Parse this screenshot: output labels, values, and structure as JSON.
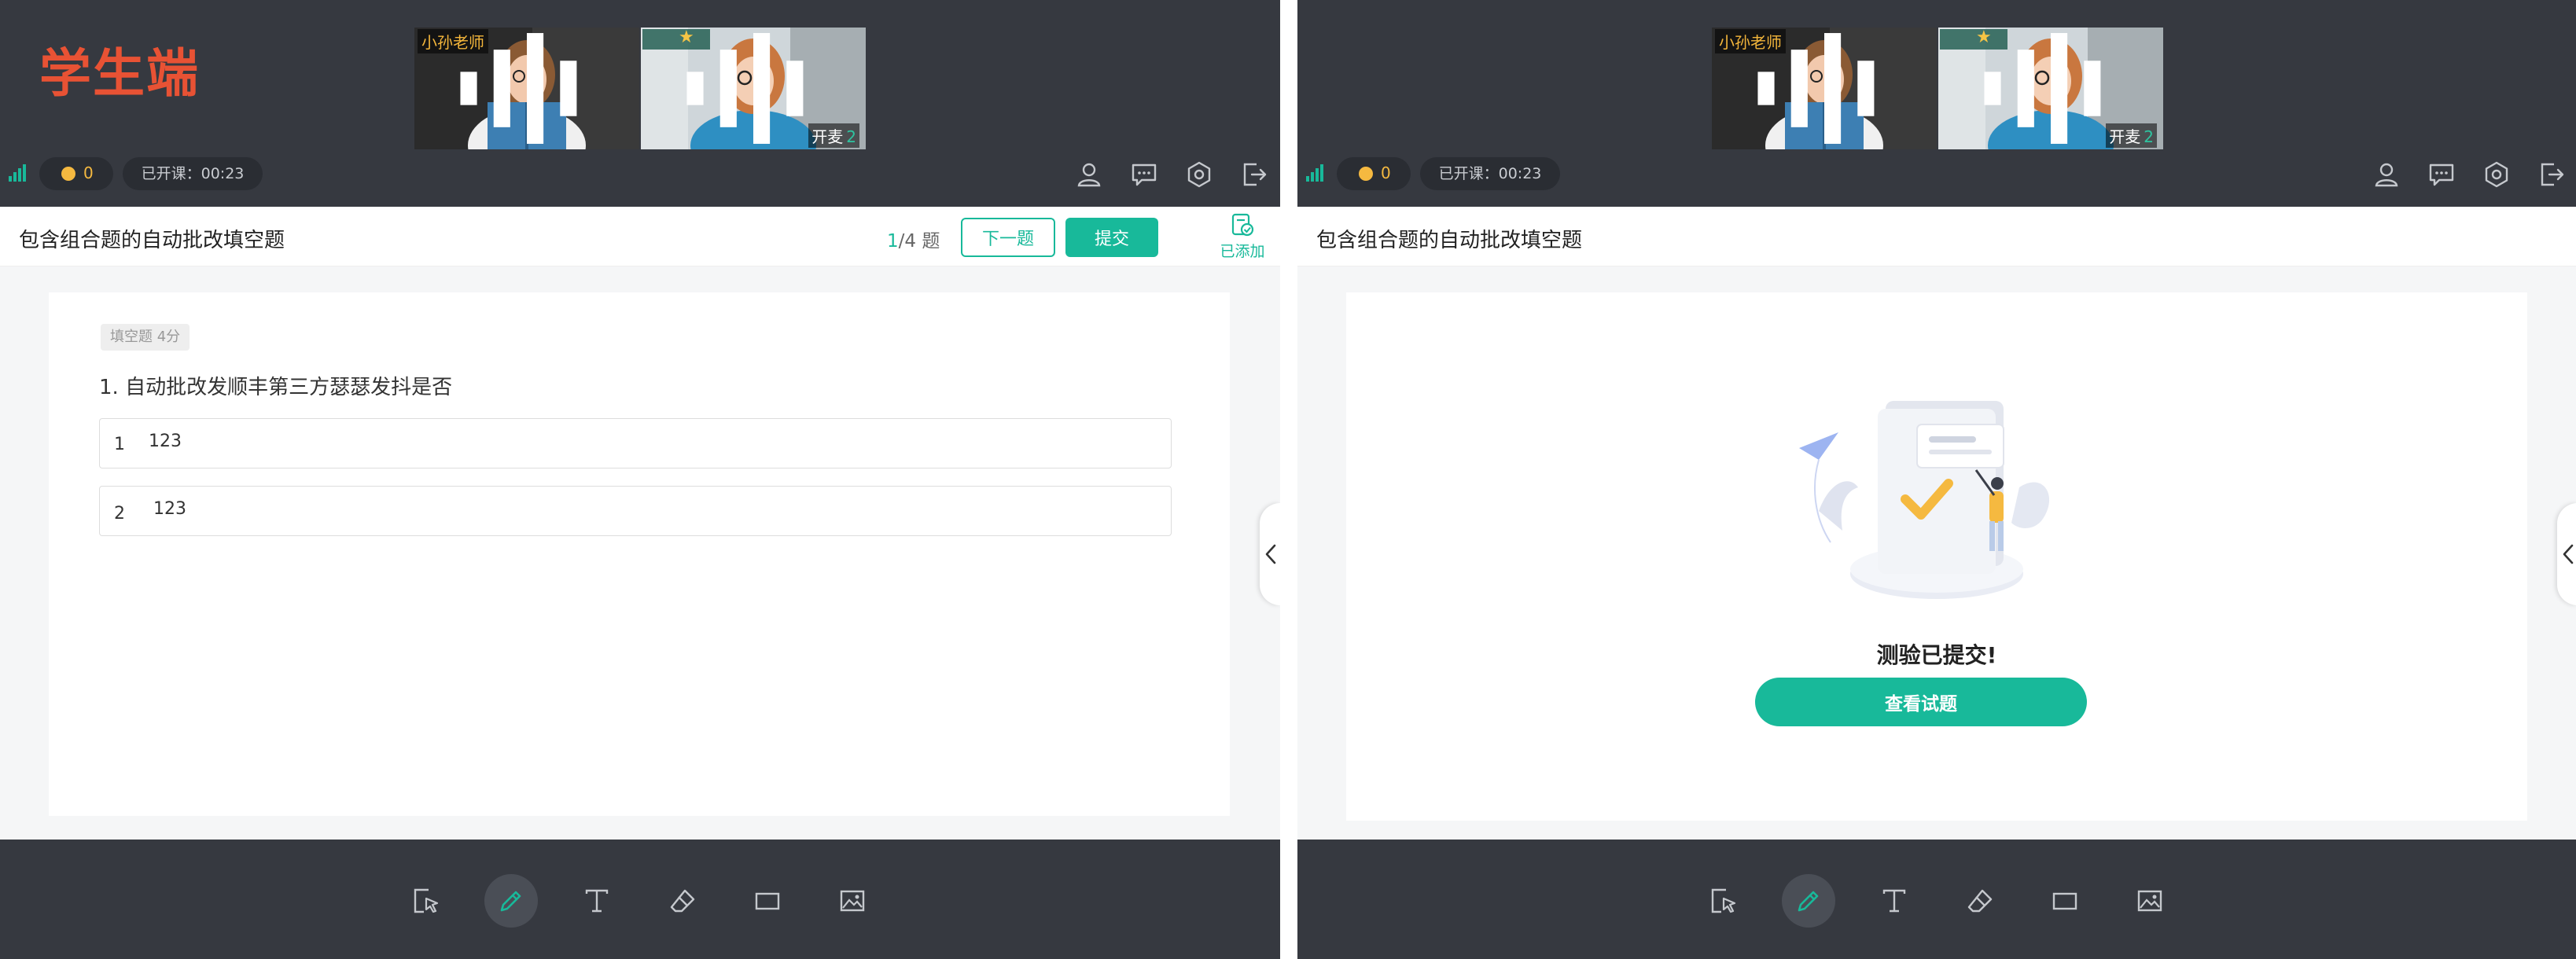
{
  "brand": "学生端",
  "colors": {
    "accent": "#18b99a",
    "brand_red": "#e85234",
    "topbar_bg": "#363940",
    "coin": "#f5b940"
  },
  "header": {
    "teacher_name": "小孙老师",
    "mic_label": "开麦",
    "mic_count": "2",
    "coin_count": "0",
    "class_time": "已开课：00:23",
    "icons": [
      "user-icon",
      "chat-icon",
      "settings-icon",
      "exit-icon"
    ]
  },
  "quiz": {
    "title": "包含组合题的自动批改填空题",
    "progress_current": "1",
    "progress_total": "/4 题",
    "next_label": "下一题",
    "submit_label": "提交",
    "added_label": "已添加",
    "question_tag": "填空题  4分",
    "question_text": "1. 自动批改发顺丰第三方瑟瑟发抖是否",
    "answers": [
      {
        "num": "1",
        "value": "123"
      },
      {
        "num": "2",
        "value": "123"
      }
    ]
  },
  "result": {
    "message": "测验已提交!",
    "view_label": "查看试题"
  },
  "toolbar": {
    "tools": [
      "select-icon",
      "pen-icon",
      "text-icon",
      "eraser-icon",
      "rectangle-icon",
      "image-icon"
    ],
    "active": "pen-icon"
  }
}
